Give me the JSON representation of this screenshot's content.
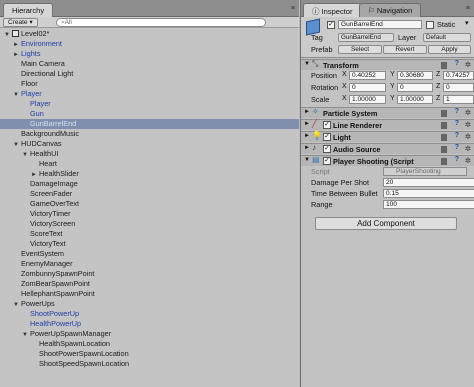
{
  "hierarchy": {
    "tab_label": "Hierarchy",
    "menu_icon": "≡",
    "create_label": "Create",
    "search_placeholder": "All",
    "items": [
      {
        "label": "Level02*",
        "depth": 0,
        "arrow": "▼",
        "blue": false,
        "scene": true
      },
      {
        "label": "Environment",
        "depth": 1,
        "arrow": "►",
        "blue": true
      },
      {
        "label": "Lights",
        "depth": 1,
        "arrow": "►",
        "blue": true
      },
      {
        "label": "Main Camera",
        "depth": 1,
        "arrow": "",
        "blue": false
      },
      {
        "label": "Directional Light",
        "depth": 1,
        "arrow": "",
        "blue": false
      },
      {
        "label": "Floor",
        "depth": 1,
        "arrow": "",
        "blue": false
      },
      {
        "label": "Player",
        "depth": 1,
        "arrow": "▼",
        "blue": true
      },
      {
        "label": "Player",
        "depth": 2,
        "arrow": "",
        "blue": true
      },
      {
        "label": "Gun",
        "depth": 2,
        "arrow": "",
        "blue": true
      },
      {
        "label": "GunBarrelEnd",
        "depth": 2,
        "arrow": "",
        "blue": true,
        "selected": true
      },
      {
        "label": "BackgroundMusic",
        "depth": 1,
        "arrow": "",
        "blue": false
      },
      {
        "label": "HUDCanvas",
        "depth": 1,
        "arrow": "▼",
        "blue": false
      },
      {
        "label": "HealthUI",
        "depth": 2,
        "arrow": "▼",
        "blue": false
      },
      {
        "label": "Heart",
        "depth": 3,
        "arrow": "",
        "blue": false
      },
      {
        "label": "HealthSlider",
        "depth": 3,
        "arrow": "►",
        "blue": false
      },
      {
        "label": "DamageImage",
        "depth": 2,
        "arrow": "",
        "blue": false
      },
      {
        "label": "ScreenFader",
        "depth": 2,
        "arrow": "",
        "blue": false
      },
      {
        "label": "GameOverText",
        "depth": 2,
        "arrow": "",
        "blue": false
      },
      {
        "label": "VictoryTimer",
        "depth": 2,
        "arrow": "",
        "blue": false
      },
      {
        "label": "VictoryScreen",
        "depth": 2,
        "arrow": "",
        "blue": false
      },
      {
        "label": "ScoreText",
        "depth": 2,
        "arrow": "",
        "blue": false
      },
      {
        "label": "VictoryText",
        "depth": 2,
        "arrow": "",
        "blue": false
      },
      {
        "label": "EventSystem",
        "depth": 1,
        "arrow": "",
        "blue": false
      },
      {
        "label": "EnemyManager",
        "depth": 1,
        "arrow": "",
        "blue": false
      },
      {
        "label": "ZombunnySpawnPoint",
        "depth": 1,
        "arrow": "",
        "blue": false
      },
      {
        "label": "ZomBearSpawnPoint",
        "depth": 1,
        "arrow": "",
        "blue": false
      },
      {
        "label": "HellephantSpawnPoint",
        "depth": 1,
        "arrow": "",
        "blue": false
      },
      {
        "label": "PowerUps",
        "depth": 1,
        "arrow": "▼",
        "blue": false
      },
      {
        "label": "ShootPowerUp",
        "depth": 2,
        "arrow": "",
        "blue": true
      },
      {
        "label": "HealthPowerUp",
        "depth": 2,
        "arrow": "",
        "blue": true
      },
      {
        "label": "PowerUpSpawnManager",
        "depth": 2,
        "arrow": "▼",
        "blue": false
      },
      {
        "label": "HealthSpawnLocation",
        "depth": 3,
        "arrow": "",
        "blue": false
      },
      {
        "label": "ShootPowerSpawnLocation",
        "depth": 3,
        "arrow": "",
        "blue": false
      },
      {
        "label": "ShootSpeedSpawnLocation",
        "depth": 3,
        "arrow": "",
        "blue": false
      }
    ]
  },
  "inspector": {
    "tab_inspector": "Inspector",
    "tab_navigation": "Navigation",
    "object_name": "GunBarrelEnd",
    "static_label": "Static",
    "tag_label": "Tag",
    "tag_value": "GunBarrelEnd",
    "layer_label": "Layer",
    "layer_value": "Default",
    "prefab_label": "Prefab",
    "select_label": "Select",
    "revert_label": "Revert",
    "apply_label": "Apply",
    "transform": {
      "title": "Transform",
      "position_label": "Position",
      "rotation_label": "Rotation",
      "scale_label": "Scale",
      "position": {
        "x": "0.40252",
        "y": "0.30680",
        "z": "0.74257"
      },
      "rotation": {
        "x": "0",
        "y": "0",
        "z": "0"
      },
      "scale": {
        "x": "1.00000",
        "y": "1.00000",
        "z": "1"
      }
    },
    "components": [
      {
        "title": "Particle System"
      },
      {
        "title": "Line Renderer"
      },
      {
        "title": "Light"
      },
      {
        "title": "Audio Source"
      },
      {
        "title": "Player Shooting (Script"
      }
    ],
    "script_label": "Script",
    "script_value": "PlayerShooting",
    "damage_label": "Damage Per Shot",
    "damage_value": "20",
    "tbb_label": "Time Between Bullet",
    "tbb_value": "0.15",
    "range_label": "Range",
    "range_value": "100",
    "add_component_label": "Add Component"
  },
  "colors": {
    "selection": "#7f8fad",
    "prefab_blue": "#1d3ea8"
  }
}
